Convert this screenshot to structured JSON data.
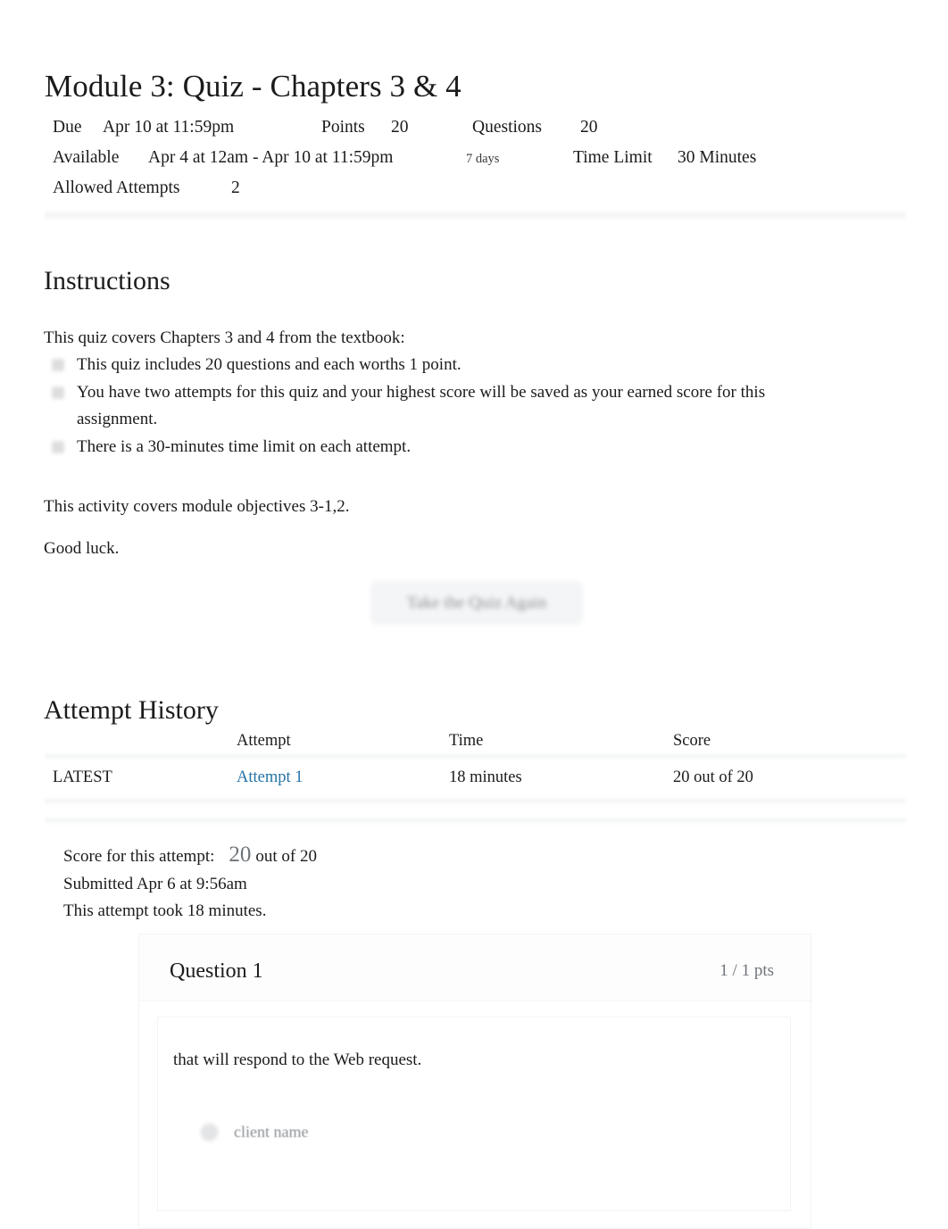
{
  "page_title": "Module 3: Quiz - Chapters 3 & 4",
  "meta": {
    "row1": {
      "due_label": "Due",
      "due_value": "Apr 10 at 11:59pm",
      "points_label": "Points",
      "points_value": "20",
      "questions_label": "Questions",
      "questions_value": "20"
    },
    "row2": {
      "available_label": "Available",
      "available_value": "Apr 4 at 12am - Apr 10 at 11:59pm",
      "duration": "7 days",
      "time_limit_label": "Time Limit",
      "time_limit_value": "30 Minutes"
    },
    "row3": {
      "allowed_attempts_label": "Allowed Attempts",
      "allowed_attempts_value": "2"
    }
  },
  "instructions": {
    "heading": "Instructions",
    "intro": "This quiz covers Chapters 3 and 4 from the textbook:",
    "bullets": [
      "This quiz includes 20 questions and each worths 1 point.",
      "You have two attempts for this quiz and your highest score will be saved as your earned score for this assignment.",
      "There is a 30-minutes time limit on each attempt."
    ],
    "objectives": "This activity covers module objectives 3-1,2.",
    "closing": "Good luck."
  },
  "retake_button": {
    "label": "Take the Quiz Again"
  },
  "attempt_history": {
    "heading": "Attempt History",
    "columns": {
      "kept": "",
      "attempt": "Attempt",
      "time": "Time",
      "score": "Score"
    },
    "rows": [
      {
        "kept": "LATEST",
        "attempt": "Attempt 1",
        "time": "18 minutes",
        "score": "20 out of 20"
      }
    ]
  },
  "score_summary": {
    "score_label": "Score for this attempt:",
    "score_value": "20",
    "score_outof": "out of 20",
    "submitted": "Submitted Apr 6 at 9:56am",
    "duration": "This attempt took 18 minutes."
  },
  "question": {
    "name": "Question 1",
    "points": "1 / 1 pts",
    "text": "that will respond to the Web request.",
    "answers": [
      {
        "label": "client name"
      }
    ]
  },
  "colors": {
    "link": "#2573a7",
    "text": "#1b1b1b",
    "muted": "#6f7479",
    "disabled": "#8b8f93"
  }
}
